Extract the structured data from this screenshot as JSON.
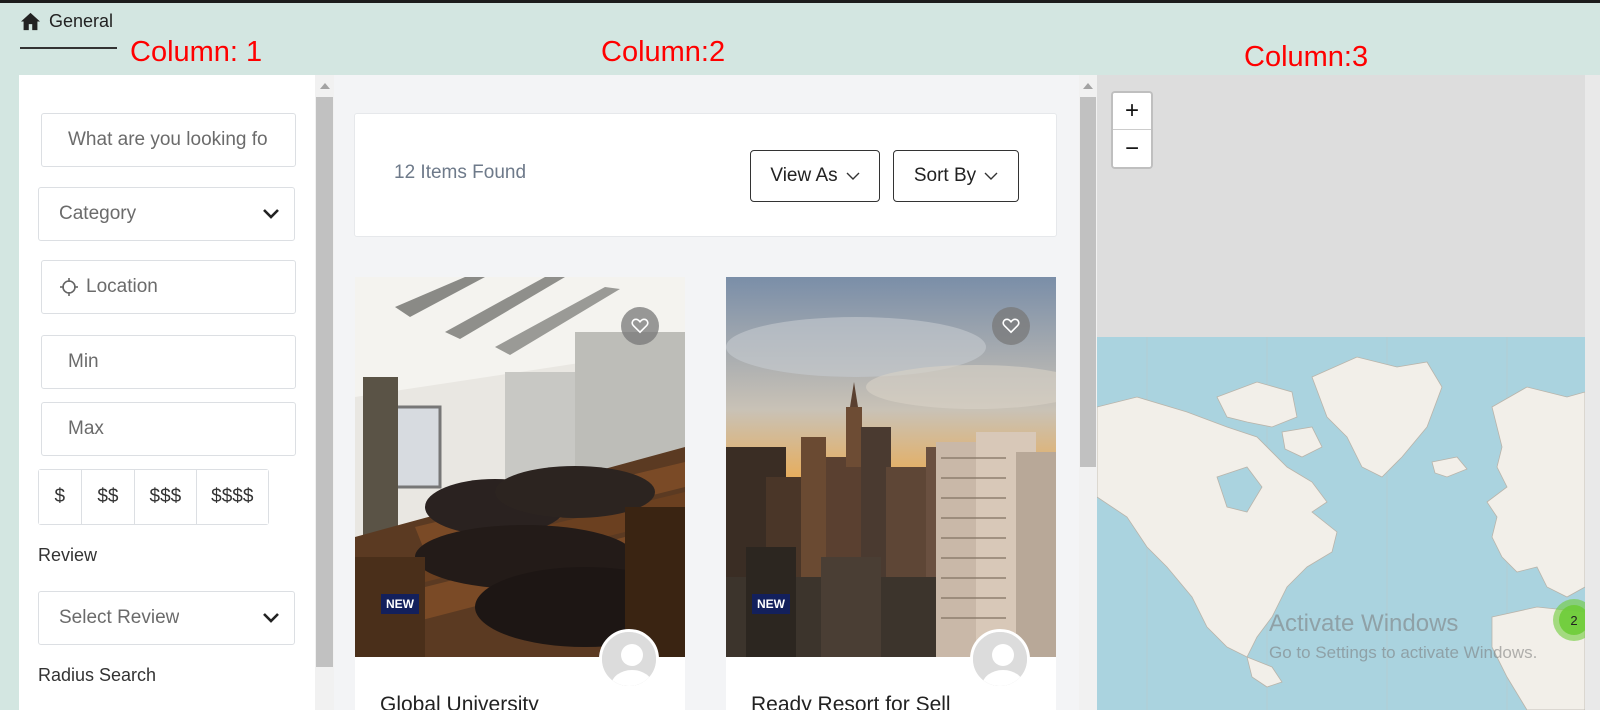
{
  "nav": {
    "label": "General"
  },
  "annotations": {
    "column1": "Column: 1",
    "column2": "Column:2",
    "column3": "Column:3"
  },
  "filters": {
    "search_placeholder": "What are you looking fo",
    "category": "Category",
    "location": "Location",
    "min": "Min",
    "max": "Max",
    "price_levels": [
      "$",
      "$$",
      "$$$",
      "$$$$"
    ],
    "review_label": "Review",
    "review_select": "Select Review",
    "radius_label": "Radius Search"
  },
  "results": {
    "count_text": "12 Items Found",
    "view_as": "View As",
    "sort_by": "Sort By"
  },
  "cards": [
    {
      "title": "Global University",
      "badge": "NEW"
    },
    {
      "title": "Ready Resort for Sell",
      "badge": "NEW"
    }
  ],
  "map": {
    "zoom_in": "+",
    "zoom_out": "−",
    "cluster_count": "2",
    "watermark_title": "Activate Windows",
    "watermark_sub": "Go to Settings to activate Windows."
  },
  "colors": {
    "page_bg": "#d3e6e1",
    "annotation_red": "#ff0000",
    "badge_navy": "#13205c",
    "ocean": "#aad3df",
    "cluster_green": "#6ecc39"
  }
}
